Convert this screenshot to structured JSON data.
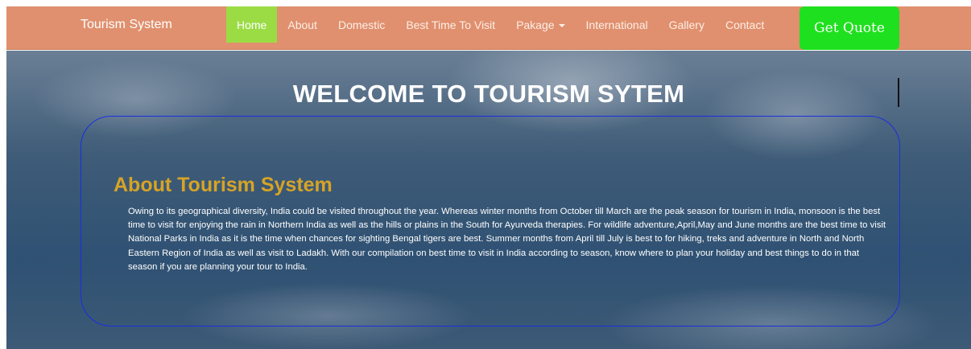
{
  "navbar": {
    "brand": "Tourism System",
    "items": [
      {
        "label": "Home",
        "active": true
      },
      {
        "label": "About",
        "active": false
      },
      {
        "label": "Domestic",
        "active": false
      },
      {
        "label": "Best Time To Visit",
        "active": false
      },
      {
        "label": "Pakage",
        "active": false,
        "dropdown": true
      },
      {
        "label": "International",
        "active": false
      },
      {
        "label": "Gallery",
        "active": false
      },
      {
        "label": "Contact",
        "active": false
      }
    ],
    "quote_button": "Get Quote"
  },
  "hero": {
    "title": "WELCOME TO TOURISM SYTEM"
  },
  "about": {
    "heading": "About Tourism System",
    "text": "Owing to its geographical diversity, India could be visited throughout the year. Whereas winter months from October till March are the peak season for tourism in India, monsoon is the best time to visit for enjoying the rain in Northern India as well as the hills or plains in the South for Ayurveda therapies. For wildlife adventure,April,May and June months are the best time to visit National Parks in India as it is the time when chances for sighting Bengal tigers are best. Summer months from April till July is best to for hiking, treks and adventure in North and North Eastern Region of India as well as visit to Ladakh. With our compilation on best time to visit in India according to season, know where to plan your holiday and best things to do in that season if you are planning your tour to India."
  },
  "colors": {
    "navbar_bg": "#e0906e",
    "active_nav": "#9bdc45",
    "quote_button": "#1ee01e",
    "heading_gold": "#d7a326",
    "box_border": "#1a2ee0"
  }
}
